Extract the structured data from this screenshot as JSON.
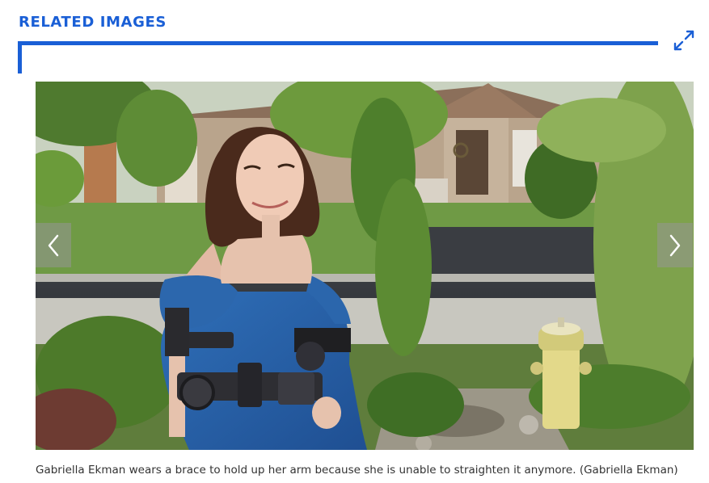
{
  "section": {
    "title": "RELATED IMAGES",
    "expand_icon": "expand-arrows-icon"
  },
  "gallery": {
    "image_alt": "Gabriella Ekman standing on a suburban sidewalk wearing an arm brace",
    "prev_icon": "chevron-left-icon",
    "next_icon": "chevron-right-icon",
    "caption": "Gabriella Ekman wears a brace to hold up her arm because she is unable to straighten it anymore. (Gabriella Ekman)"
  },
  "colors": {
    "accent": "#1a5fd6",
    "caption_text": "#333333"
  }
}
